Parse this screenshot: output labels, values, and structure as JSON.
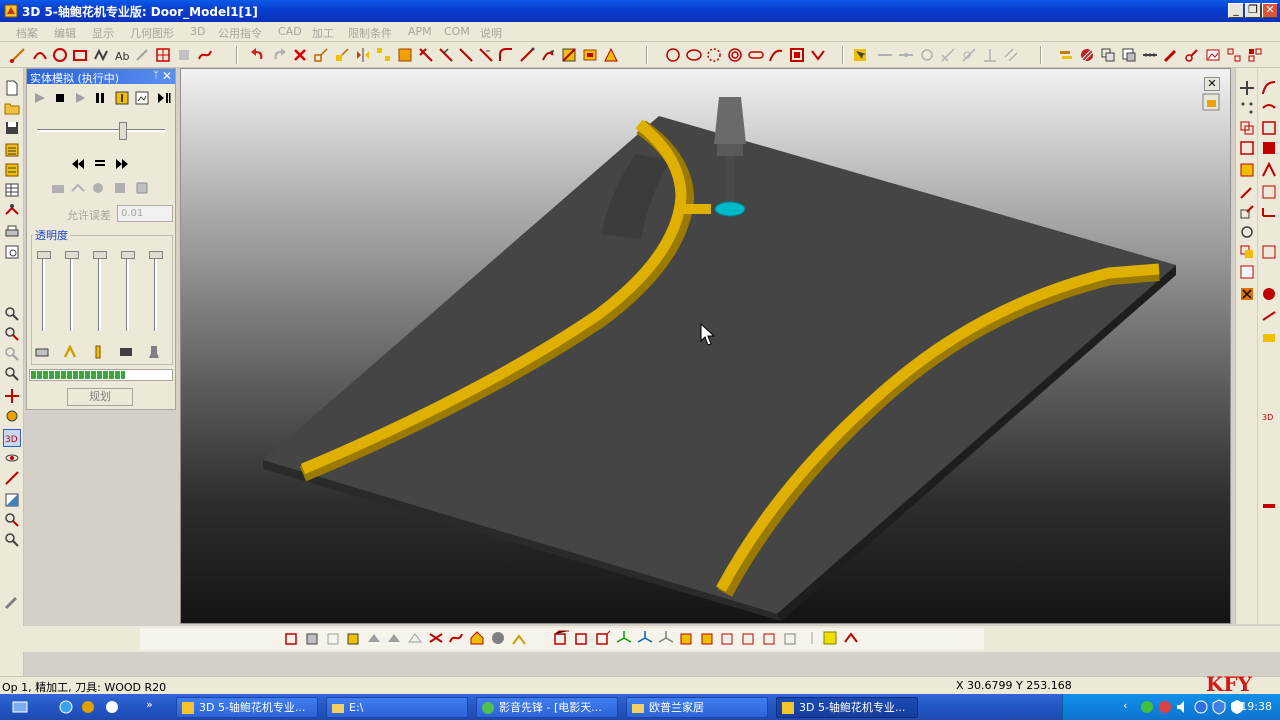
{
  "window": {
    "title": "3D 5-轴鲍花机专业版: Door_Model1[1]",
    "min_label": "_",
    "restore_label": "❐",
    "close_label": "✕"
  },
  "menu": [
    "档案",
    "编辑",
    "显示",
    "几何图形",
    "3D",
    "公用指令",
    "CAD",
    "加工",
    "限制条件",
    "APM",
    "COM",
    "说明"
  ],
  "sim_panel": {
    "title": "实体模拟 (执行中)",
    "pin": "ᛘ",
    "close": "✕",
    "tolerance_label": "允许误差",
    "tolerance_value": "0.01",
    "transparency_label": "透明度",
    "plan_button": "规划",
    "progress_fraction": 0.67
  },
  "viewport": {
    "close": "✕"
  },
  "status": {
    "operation": "Op 1, 精加工, 刀具: WOOD R20",
    "x": "X 30.6799",
    "y": "Y 253.168"
  },
  "watermark": "KFY",
  "taskbar": {
    "tasks": [
      {
        "label": "3D 5-轴鲍花机专业...",
        "active": false
      },
      {
        "label": "E:\\",
        "active": false
      },
      {
        "label": "影音先锋 - [电影天...",
        "active": false
      },
      {
        "label": "欧普兰家居",
        "active": false
      },
      {
        "label": "3D 5-轴鲍花机专业...",
        "active": true
      }
    ],
    "clock": "19:38"
  },
  "colors": {
    "title_bar": "#0a3fd0",
    "chrome": "#ece9d8",
    "groove": "#e0b000",
    "taskbar": "#2457c4"
  }
}
